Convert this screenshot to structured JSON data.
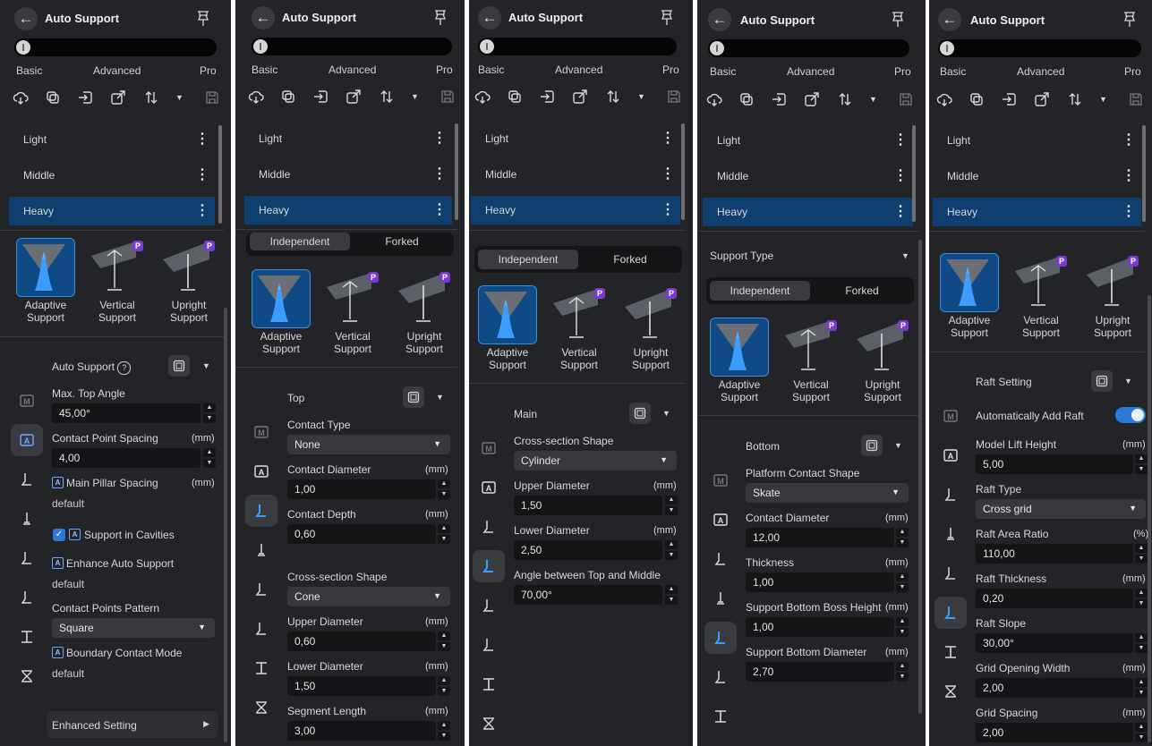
{
  "common": {
    "title": "Auto Support",
    "back_label": "←",
    "levels": [
      "Basic",
      "Advanced",
      "Pro"
    ],
    "presets": [
      "Light",
      "Middle",
      "Heavy"
    ],
    "menu_dots": "⋮",
    "support_types": [
      "Independent",
      "Forked"
    ],
    "cards": [
      {
        "line1": "Adaptive",
        "line2": "Support"
      },
      {
        "line1": "Vertical",
        "line2": "Support"
      },
      {
        "line1": "Upright",
        "line2": "Support"
      }
    ],
    "pro_badge": "P"
  },
  "p1": {
    "section": "Auto Support",
    "max_top_angle_label": "Max. Top Angle",
    "max_top_angle_value": "45,00°",
    "cps_label": "Contact Point Spacing",
    "cps_unit": "(mm)",
    "cps_value": "4,00",
    "mps_label": "Main Pillar Spacing",
    "mps_unit": "(mm)",
    "mps_value": "default",
    "cavities_label": "Support in Cavities",
    "enhance_label": "Enhance Auto Support",
    "enhance_value": "default",
    "pattern_label": "Contact Points Pattern",
    "pattern_value": "Square",
    "boundary_label": "Boundary Contact Mode",
    "boundary_value": "default",
    "enhanced_setting": "Enhanced Setting"
  },
  "p2": {
    "section": "Top",
    "contact_type_label": "Contact Type",
    "contact_type_value": "None",
    "contact_diameter_label": "Contact Diameter",
    "contact_diameter_unit": "(mm)",
    "contact_diameter_value": "1,00",
    "contact_depth_label": "Contact Depth",
    "contact_depth_unit": "(mm)",
    "contact_depth_value": "0,60",
    "cross_label": "Cross-section Shape",
    "cross_value": "Cone",
    "upper_label": "Upper Diameter",
    "upper_unit": "(mm)",
    "upper_value": "0,60",
    "lower_label": "Lower Diameter",
    "lower_unit": "(mm)",
    "lower_value": "1,50",
    "segment_label": "Segment Length",
    "segment_unit": "(mm)",
    "segment_value": "3,00"
  },
  "p3": {
    "section": "Main",
    "cross_label": "Cross-section Shape",
    "cross_value": "Cylinder",
    "upper_label": "Upper Diameter",
    "upper_unit": "(mm)",
    "upper_value": "1,50",
    "lower_label": "Lower Diameter",
    "lower_unit": "(mm)",
    "lower_value": "2,50",
    "angle_label": "Angle between Top and Middle",
    "angle_value": "70,00°"
  },
  "p4": {
    "support_type_label": "Support Type",
    "section": "Bottom",
    "platform_label": "Platform Contact Shape",
    "platform_value": "Skate",
    "contact_diameter_label": "Contact Diameter",
    "contact_diameter_unit": "(mm)",
    "contact_diameter_value": "12,00",
    "thickness_label": "Thickness",
    "thickness_unit": "(mm)",
    "thickness_value": "1,00",
    "boss_label": "Support Bottom Boss Height",
    "boss_unit": "(mm)",
    "boss_value": "1,00",
    "bottom_diam_label": "Support Bottom Diameter",
    "bottom_diam_unit": "(mm)",
    "bottom_diam_value": "2,70"
  },
  "p5": {
    "section": "Raft Setting",
    "auto_raft_label": "Automatically Add Raft",
    "lift_label": "Model Lift Height",
    "lift_unit": "(mm)",
    "lift_value": "5,00",
    "raft_type_label": "Raft Type",
    "raft_type_value": "Cross grid",
    "area_label": "Raft Area Ratio",
    "area_unit": "(%)",
    "area_value": "110,00",
    "thick_label": "Raft Thickness",
    "thick_unit": "(mm)",
    "thick_value": "0,20",
    "slope_label": "Raft Slope",
    "slope_value": "30,00°",
    "grid_open_label": "Grid Opening Width",
    "grid_open_unit": "(mm)",
    "grid_open_value": "2,00",
    "grid_spacing_label": "Grid Spacing",
    "grid_spacing_unit": "(mm)",
    "grid_spacing_value": "2,00"
  }
}
